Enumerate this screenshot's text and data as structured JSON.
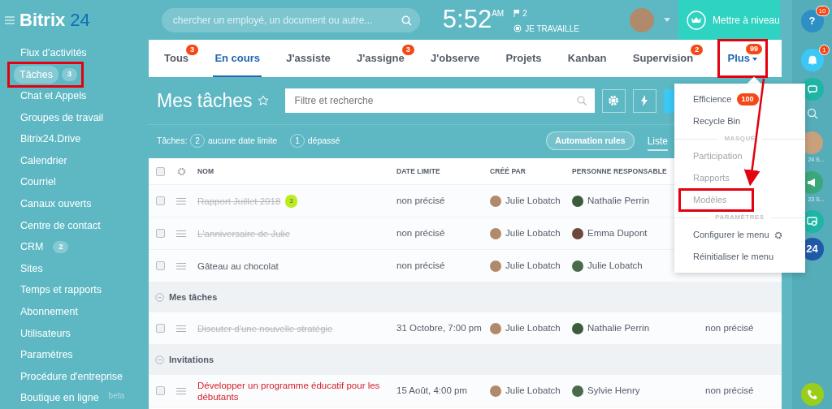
{
  "header": {
    "logo_text": "Bitrix",
    "logo_accent": "24",
    "search": {
      "placeholder": "chercher un employé, un document ou autre..."
    },
    "clock": {
      "time": "5:52",
      "meridiem": "AM",
      "flag_count": "2",
      "status": "JE TRAVAILLE"
    },
    "upgrade_button": "Mettre à niveau"
  },
  "sidebar": {
    "items": [
      {
        "label": "Flux d'activités",
        "selected": false,
        "highlighted": false
      },
      {
        "label": "Tâches",
        "counter": "3",
        "selected": true,
        "highlighted": true
      },
      {
        "label": "Chat et Appels",
        "selected": false,
        "highlighted": false
      },
      {
        "label": "Groupes de travail",
        "selected": false,
        "highlighted": false
      },
      {
        "label": "Bitrix24.Drive",
        "selected": false,
        "highlighted": false
      },
      {
        "label": "Calendrier",
        "selected": false,
        "highlighted": false
      },
      {
        "label": "Courriel",
        "selected": false,
        "highlighted": false
      },
      {
        "label": "Canaux ouverts",
        "selected": false,
        "highlighted": false
      },
      {
        "label": "Centre de contact",
        "selected": false,
        "highlighted": false
      },
      {
        "label": "CRM",
        "counter": "2",
        "selected": false,
        "highlighted": false
      },
      {
        "label": "Sites",
        "selected": false,
        "highlighted": false
      },
      {
        "label": "Temps et rapports",
        "selected": false,
        "highlighted": false
      },
      {
        "label": "Abonnement",
        "selected": false,
        "highlighted": false
      },
      {
        "label": "Utilisateurs",
        "selected": false,
        "highlighted": false
      },
      {
        "label": "Paramètres",
        "selected": false,
        "highlighted": false
      },
      {
        "label": "Procédure d'entreprise",
        "selected": false,
        "highlighted": false
      },
      {
        "label": "Boutique en ligne",
        "tag": "beta",
        "selected": false,
        "highlighted": false
      }
    ]
  },
  "tabs": [
    {
      "label": "Tous",
      "badge": "3",
      "selected": false,
      "highlighted": false
    },
    {
      "label": "En cours",
      "selected": true,
      "highlighted": false
    },
    {
      "label": "J'assiste",
      "selected": false,
      "highlighted": false
    },
    {
      "label": "J'assigne",
      "badge": "3",
      "selected": false,
      "highlighted": false
    },
    {
      "label": "J'observe",
      "selected": false,
      "highlighted": false
    },
    {
      "label": "Projets",
      "selected": false,
      "highlighted": false
    },
    {
      "label": "Kanban",
      "selected": false,
      "highlighted": false
    },
    {
      "label": "Supervision",
      "badge": "2",
      "selected": false,
      "highlighted": false
    },
    {
      "label": "Plus",
      "badge": "99",
      "dropdown": true,
      "selected": false,
      "highlighted": true
    }
  ],
  "page_title": "Mes tâches",
  "filter": {
    "placeholder": "Filtre et recherche"
  },
  "counters": {
    "label": "Tâches:",
    "items": [
      {
        "count": "2",
        "text": "aucune date limite"
      },
      {
        "count": "1",
        "text": "dépassé"
      }
    ]
  },
  "automation_button": "Automation rules",
  "views": [
    {
      "label": "Liste",
      "selected": true
    }
  ],
  "table": {
    "select_all_checked": false,
    "columns": [
      "NOM",
      "DATE LIMITE",
      "CRÉÉ PAR",
      "PERSONNE RESPONSABLE"
    ],
    "rows": [
      {
        "kind": "task",
        "checked": false,
        "name": "Rapport Juillet 2018",
        "done": true,
        "overdue": false,
        "comments": "3",
        "deadline": "non précisé",
        "created_by": "Julie Lobatch",
        "responsible": "Nathalie Perrin"
      },
      {
        "kind": "task",
        "checked": false,
        "name": "L'anniversaire de Julie",
        "done": true,
        "overdue": false,
        "deadline": "non précisé",
        "created_by": "Julie Lobatch",
        "responsible": "Emma Dupont"
      },
      {
        "kind": "task",
        "checked": false,
        "name": "Gâteau au chocolat",
        "done": false,
        "overdue": false,
        "deadline": "non précisé",
        "created_by": "Julie Lobatch",
        "responsible": "Julie Lobatch"
      },
      {
        "kind": "group",
        "label": "Mes tâches"
      },
      {
        "kind": "task",
        "checked": false,
        "name": "Discuter d'une nouvelle stratégie",
        "done": true,
        "overdue": false,
        "deadline": "31 Octobre, 7:00 pm",
        "created_by": "Julie Lobatch",
        "responsible": "Nathalie Perrin",
        "column_5": "non précisé"
      },
      {
        "kind": "group",
        "label": "Invitations"
      },
      {
        "kind": "task",
        "checked": false,
        "name": "Développer un programme éducatif pour les débutants",
        "done": false,
        "overdue": true,
        "deadline": "15 Août, 4:00 pm",
        "created_by": "Julie Lobatch",
        "responsible": "Sylvie Henry",
        "column_5": "non précisé"
      }
    ]
  },
  "more_menu": {
    "items": [
      {
        "kind": "item",
        "label": "Efficience",
        "badge": "100",
        "hidden": false,
        "highlighted": false
      },
      {
        "kind": "item",
        "label": "Recycle Bin",
        "hidden": false,
        "highlighted": false
      },
      {
        "kind": "section",
        "label": "MASQUÉ"
      },
      {
        "kind": "item",
        "label": "Participation",
        "hidden": true,
        "highlighted": false
      },
      {
        "kind": "item",
        "label": "Rapports",
        "hidden": true,
        "highlighted": false
      },
      {
        "kind": "item",
        "label": "Modèles",
        "hidden": true,
        "highlighted": true
      },
      {
        "kind": "section",
        "label": "PARAMÈTRES"
      },
      {
        "kind": "config",
        "label": "Configurer le menu",
        "hidden": false,
        "highlighted": false
      },
      {
        "kind": "item",
        "label": "Réinitialiser le menu",
        "hidden": false,
        "highlighted": false
      }
    ]
  },
  "right_bar": [
    {
      "kind": "help",
      "symbol": "?",
      "badge": "10"
    },
    {
      "kind": "bell",
      "badge": "1"
    },
    {
      "kind": "chat"
    },
    {
      "kind": "search"
    },
    {
      "kind": "avatar",
      "caption": "24 S..."
    },
    {
      "kind": "megaphone",
      "caption": "23 S..."
    },
    {
      "kind": "chat-search"
    },
    {
      "kind": "logo",
      "text": "24"
    },
    {
      "kind": "phone"
    }
  ]
}
